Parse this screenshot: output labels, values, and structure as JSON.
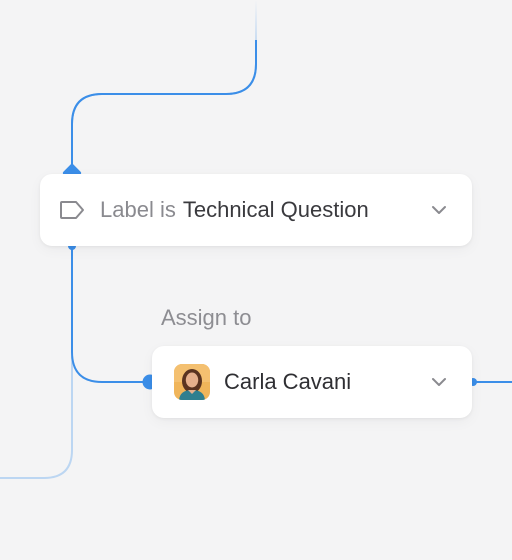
{
  "condition": {
    "prefix": "Label is",
    "value": "Technical Question",
    "icon": "tag-outline-icon"
  },
  "assign": {
    "section_label": "Assign to",
    "assignee_name": "Carla Cavani",
    "avatar_icon": "user-avatar"
  },
  "colors": {
    "background": "#f4f4f5",
    "connector": "#3b8ee8",
    "connector_faded": "#bcd6f2",
    "card": "#ffffff"
  }
}
